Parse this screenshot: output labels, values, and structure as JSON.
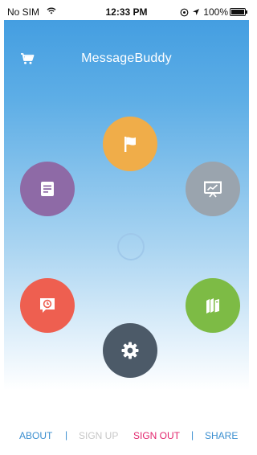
{
  "status_bar": {
    "carrier": "No SIM",
    "time": "12:33 PM",
    "battery": "100%",
    "battery_level": 1.0,
    "icons": [
      "wifi-icon",
      "alarm-icon",
      "location-arrow-icon",
      "battery-icon"
    ]
  },
  "header": {
    "title": "MessageBuddy",
    "cart_icon": "cart-icon"
  },
  "menu": {
    "buttons": [
      {
        "icon": "flag-icon",
        "color": "#f0ad49"
      },
      {
        "icon": "note-icon",
        "color": "#8e6aa6"
      },
      {
        "icon": "presentation-chart-icon",
        "color": "#9aa4ae"
      },
      {
        "icon": "message-clock-icon",
        "color": "#ee5f50"
      },
      {
        "icon": "books-icon",
        "color": "#7dbb45"
      },
      {
        "icon": "gear-icon",
        "color": "#4c5a68"
      }
    ]
  },
  "footer": {
    "about": "ABOUT",
    "separator": "|",
    "sign_up": "SIGN UP",
    "sign_out": "SIGN OUT",
    "share": "SHARE"
  },
  "colors": {
    "accent_blue": "#3b8fd0",
    "sign_out": "#e2256d",
    "disabled": "#c7c7c7"
  }
}
